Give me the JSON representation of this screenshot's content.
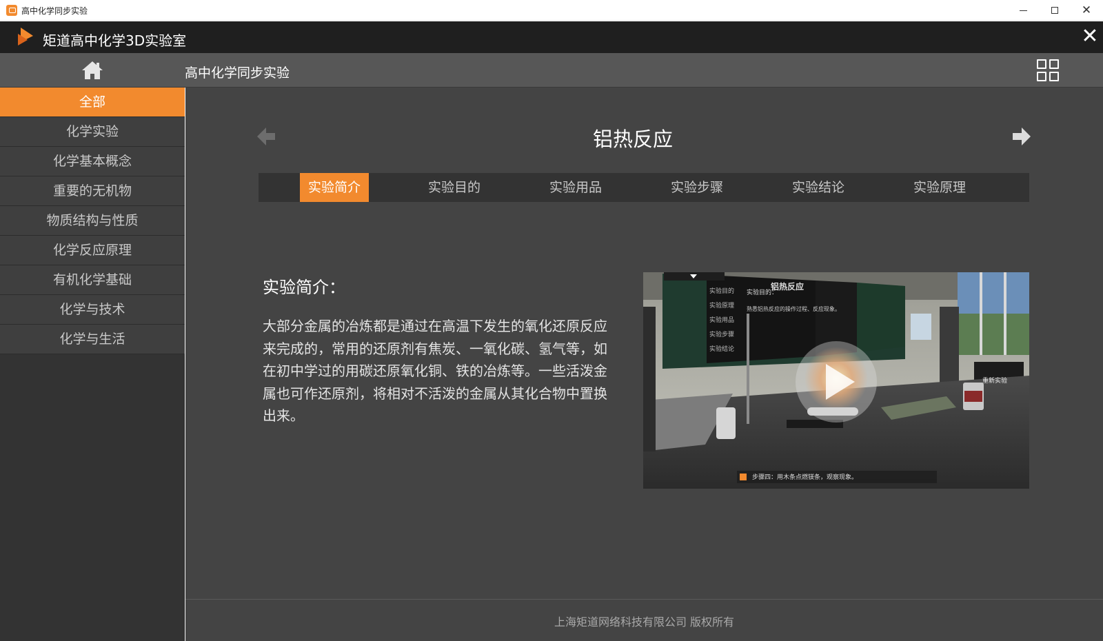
{
  "window": {
    "title": "高中化学同步实验",
    "minimize_label": "",
    "maximize_label": "",
    "close_label": "✕"
  },
  "header": {
    "app_title": "矩道高中化学3D实验室",
    "close_label": "✕"
  },
  "subheader": {
    "title": "高中化学同步实验"
  },
  "sidebar": {
    "items": [
      {
        "label": "全部",
        "active": true
      },
      {
        "label": "化学实验"
      },
      {
        "label": "化学基本概念"
      },
      {
        "label": "重要的无机物"
      },
      {
        "label": "物质结构与性质"
      },
      {
        "label": "化学反应原理"
      },
      {
        "label": "有机化学基础"
      },
      {
        "label": "化学与技术"
      },
      {
        "label": "化学与生活"
      }
    ]
  },
  "main": {
    "experiment_title": "铝热反应",
    "tabs": [
      {
        "label": "实验简介",
        "active": true
      },
      {
        "label": "实验目的"
      },
      {
        "label": "实验用品"
      },
      {
        "label": "实验步骤"
      },
      {
        "label": "实验结论"
      },
      {
        "label": "实验原理"
      }
    ],
    "intro_heading": "实验简介：",
    "intro_text": "大部分金属的冶炼都是通过在高温下发生的氧化还原反应来完成的，常用的还原剂有焦炭、一氧化碳、氢气等，如在初中学过的用碳还原氧化铜、铁的冶炼等。一些活泼金属也可作还原剂，将相对不活泼的金属从其化合物中置换出来。",
    "video": {
      "board_title": "铝热反应",
      "board_tabs": [
        "实验目的",
        "实验原理",
        "实验用品",
        "实验步骤",
        "实验结论"
      ],
      "board_line_1": "实验目的：",
      "board_line_2": "熟悉铝热反应的操作过程、反应现象。",
      "restart_label": "重新实验",
      "step_text": "步骤四：用木条点燃镁条，观察现象。"
    }
  },
  "footer": {
    "copyright": "上海矩道网络科技有限公司  版权所有"
  },
  "colors": {
    "accent": "#f28a2e",
    "header_bg": "#1f1f1f",
    "subheader_bg": "#575757",
    "sidebar_bg": "#3f3f3f",
    "main_bg": "#444444"
  },
  "icons": {
    "home": "home-icon",
    "grid": "grid-icon",
    "prev": "arrow-left-icon",
    "next": "arrow-right-icon",
    "play": "play-icon",
    "logo": "logo-icon"
  }
}
